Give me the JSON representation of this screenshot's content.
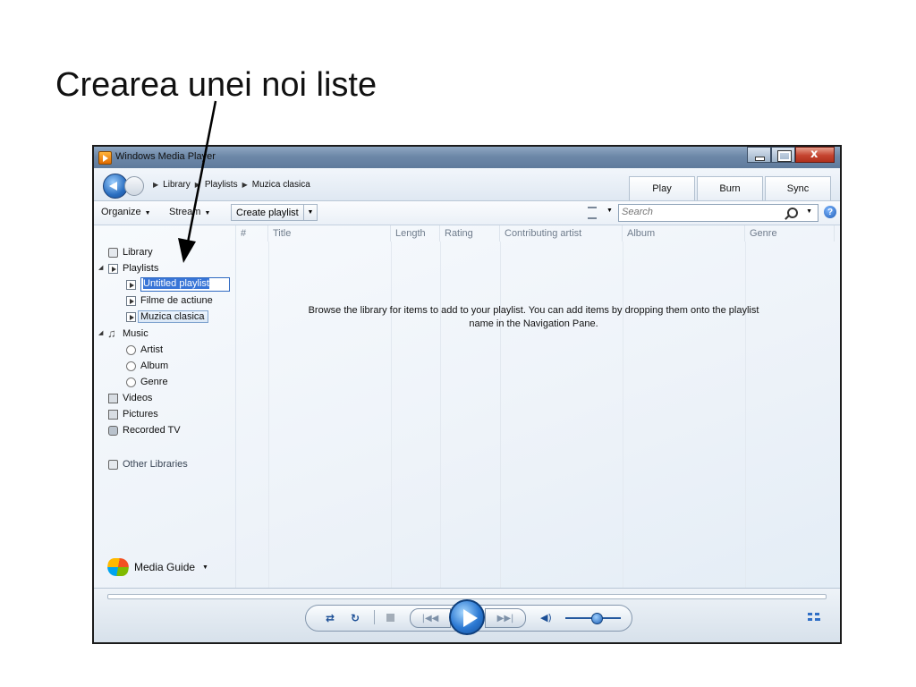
{
  "slide": {
    "title": "Crearea unei noi liste"
  },
  "window": {
    "title": "Windows Media Player",
    "buttons": {
      "minimize": "minimize-icon",
      "maximize": "maximize-icon",
      "close": "close-icon"
    }
  },
  "breadcrumb": [
    "Library",
    "Playlists",
    "Muzica clasica"
  ],
  "tabs": [
    "Play",
    "Burn",
    "Sync"
  ],
  "toolbar": {
    "organize": "Organize",
    "stream": "Stream",
    "create_playlist": "Create playlist",
    "search_placeholder": "Search"
  },
  "nav": {
    "library": "Library",
    "playlists": "Playlists",
    "rename_value": "Untitled playlist",
    "playlist_items": [
      "Filme de actiune",
      "Muzica clasica"
    ],
    "music": "Music",
    "music_items": [
      "Artist",
      "Album",
      "Genre"
    ],
    "videos": "Videos",
    "pictures": "Pictures",
    "recorded_tv": "Recorded TV",
    "other_libraries": "Other Libraries",
    "media_guide": "Media Guide"
  },
  "columns": [
    "#",
    "Title",
    "Length",
    "Rating",
    "Contributing artist",
    "Album",
    "Genre"
  ],
  "empty_message": "Browse the library for items to add to your playlist.  You can add items by dropping them onto the playlist name in the Navigation Pane.",
  "player": {
    "volume_level": 0.55,
    "seek_position": 0
  },
  "colors": {
    "accent": "#2c79d3",
    "selection": "#3875d7",
    "window_frame": "#6d88a8"
  }
}
